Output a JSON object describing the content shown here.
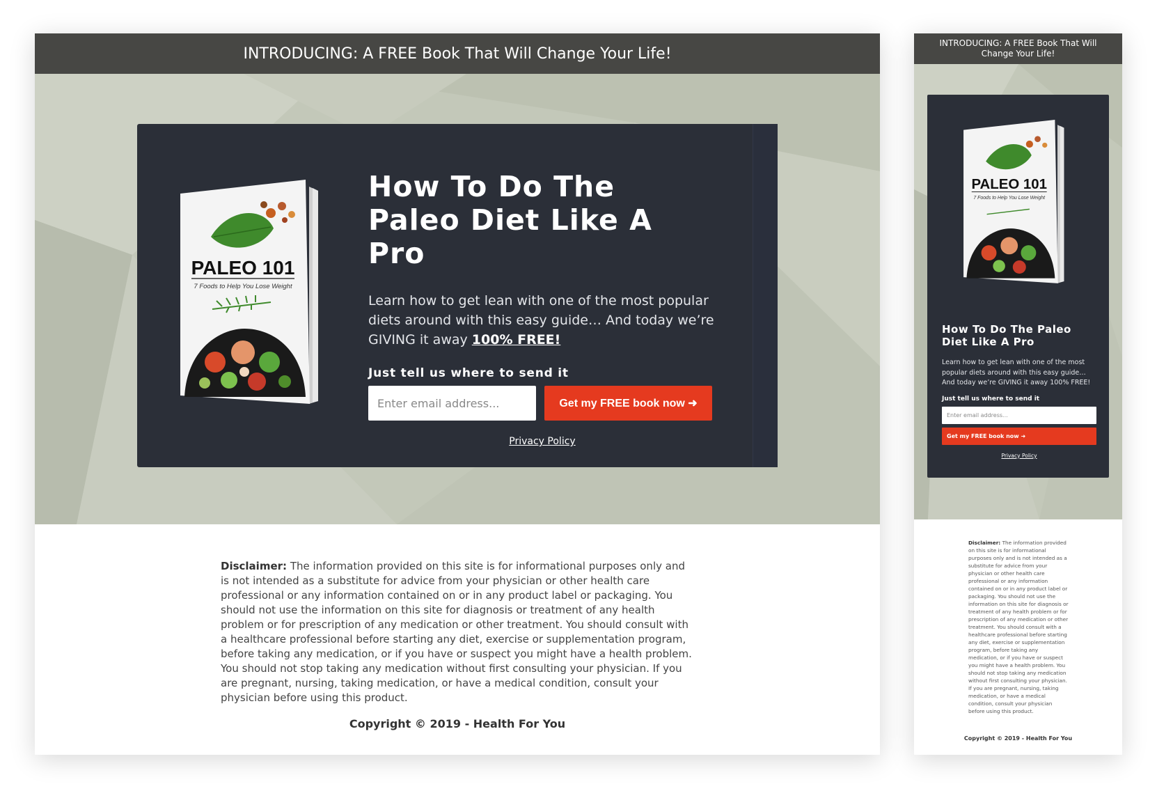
{
  "banner": {
    "text": "INTRODUCING: A FREE Book That Will Change Your Life!"
  },
  "book": {
    "title": "PALEO 101",
    "subtitle": "7 Foods to Help You Lose Weight"
  },
  "hero": {
    "headline": "How To Do The Paleo Diet Like A Pro",
    "lead": "Learn how to get lean with one of the most popular diets around with this easy guide… And today we’re GIVING it away ",
    "lead_emphasis": "100% FREE!",
    "prompt": "Just tell us where to send it",
    "email_placeholder": "Enter email address...",
    "cta_label": "Get my FREE book now ➜",
    "privacy_label": "Privacy Policy"
  },
  "footer": {
    "disclaimer_label": "Disclaimer:",
    "disclaimer_text": "The information provided on this site is for informational purposes only and is not intended as a substitute for advice from your physician or other health care professional or any information contained on or in any product label or packaging. You should not use the information on this site for diagnosis or treatment of any health problem or for prescription of any medication or other treatment. You should consult with a healthcare professional before starting any diet, exercise or supplementation program, before taking any medication, or if you have or suspect you might have a health problem. You should not stop taking any medication without first consulting your physician. If you are pregnant, nursing, taking medication, or have a medical condition, consult your physician before using this product.",
    "copyright": "Copyright © 2019 - Health For You"
  },
  "colors": {
    "topbar": "#474744",
    "hero_bg": "#c3c8b9",
    "card": "#2b2f38",
    "accent": "#e53a1f"
  }
}
